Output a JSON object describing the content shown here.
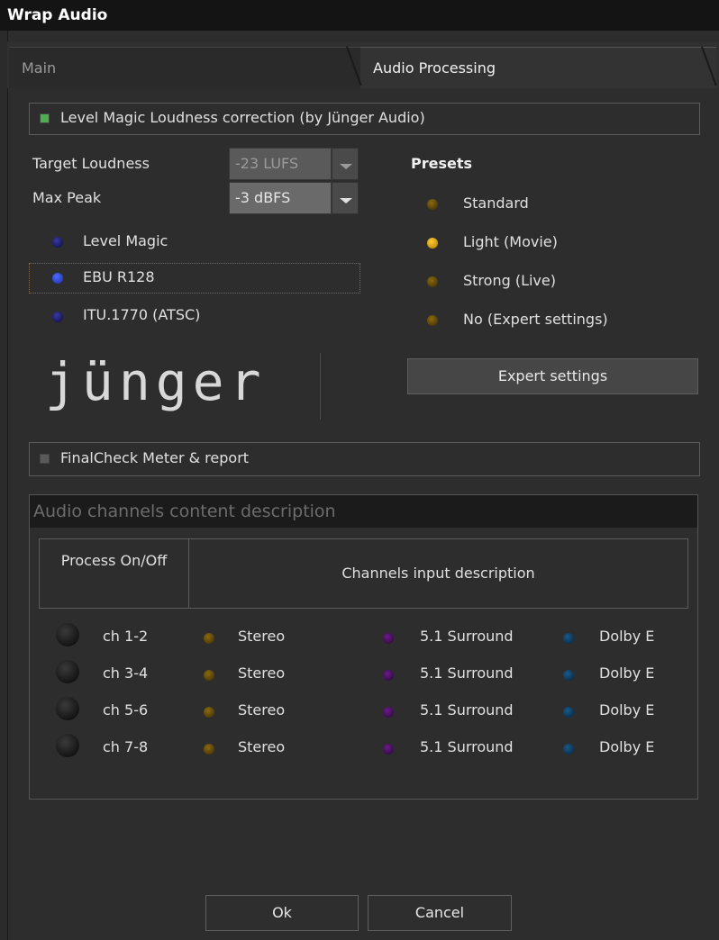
{
  "window": {
    "title": "Wrap Audio"
  },
  "tabs": [
    {
      "label": "Main",
      "active": false
    },
    {
      "label": "Audio Processing",
      "active": true
    }
  ],
  "level_magic": {
    "checkbox_label": "Level Magic Loudness correction (by Jünger Audio)",
    "checked": true,
    "target_loudness_label": "Target Loudness",
    "target_loudness_value": "-23 LUFS",
    "max_peak_label": "Max Peak",
    "max_peak_value": "-3 dBFS",
    "modes": [
      {
        "label": "Level Magic",
        "selected": false
      },
      {
        "label": "EBU R128",
        "selected": true
      },
      {
        "label": "ITU.1770 (ATSC)",
        "selected": false
      }
    ],
    "logo_text": "jünger",
    "presets_title": "Presets",
    "presets": [
      {
        "label": "Standard",
        "selected": false
      },
      {
        "label": "Light (Movie)",
        "selected": true
      },
      {
        "label": "Strong (Live)",
        "selected": false
      },
      {
        "label": "No (Expert settings)",
        "selected": false
      }
    ],
    "expert_button": "Expert settings"
  },
  "final_check": {
    "checkbox_label": "FinalCheck Meter & report",
    "checked": false
  },
  "audio_channels": {
    "section_title": "Audio channels content description",
    "col_process": "Process On/Off",
    "col_description": "Channels input description",
    "rows": [
      {
        "channel": "ch 1-2",
        "stereo": "Stereo",
        "surround": "5.1 Surround",
        "dolby": "Dolby E"
      },
      {
        "channel": "ch 3-4",
        "stereo": "Stereo",
        "surround": "5.1 Surround",
        "dolby": "Dolby E"
      },
      {
        "channel": "ch 5-6",
        "stereo": "Stereo",
        "surround": "5.1 Surround",
        "dolby": "Dolby E"
      },
      {
        "channel": "ch 7-8",
        "stereo": "Stereo",
        "surround": "5.1 Surround",
        "dolby": "Dolby E"
      }
    ]
  },
  "footer": {
    "ok": "Ok",
    "cancel": "Cancel"
  },
  "colors": {
    "checkbox_on": "#4caf50",
    "checkbox_off": "#5a5a5a",
    "led_blue_on": "#4f6cff",
    "led_amber_on": "#ffcc33"
  }
}
